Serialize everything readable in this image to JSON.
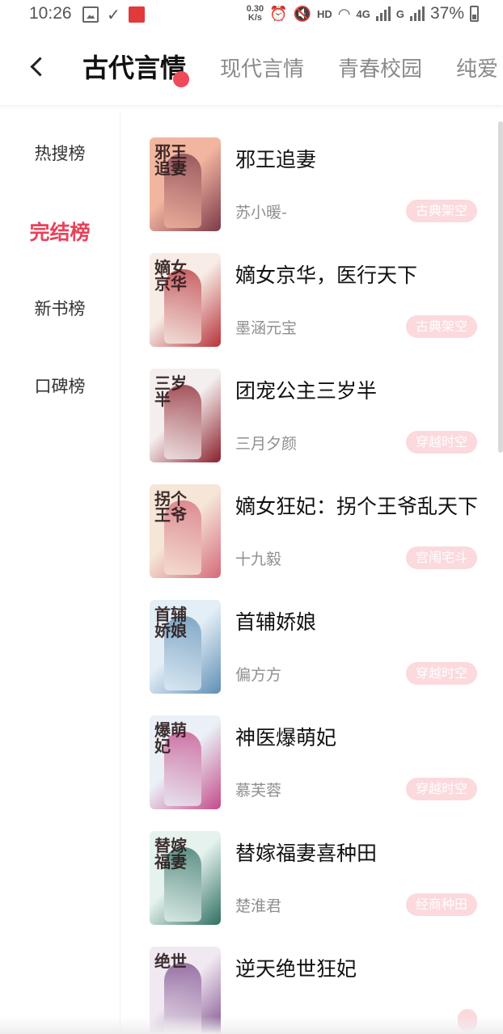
{
  "status_bar": {
    "time": "10:26",
    "speed_value": "0.30",
    "speed_unit": "K/s",
    "hd": "HD",
    "network": "4G",
    "network2": "G",
    "battery": "37%"
  },
  "header": {
    "tabs": [
      {
        "label": "古代言情",
        "active": true
      },
      {
        "label": "现代言情",
        "active": false
      },
      {
        "label": "青春校园",
        "active": false
      },
      {
        "label": "纯爱",
        "active": false
      }
    ]
  },
  "sidebar": {
    "items": [
      {
        "label": "热搜榜",
        "active": false
      },
      {
        "label": "完结榜",
        "active": true
      },
      {
        "label": "新书榜",
        "active": false
      },
      {
        "label": "口碑榜",
        "active": false
      }
    ]
  },
  "books": [
    {
      "title": "邪王追妻",
      "author": "苏小暖-",
      "tag": "古典架空",
      "cover_text": "邪王追妻",
      "cover_colors": [
        "#f2b6a0",
        "#7b3a4a"
      ]
    },
    {
      "title": "嫡女京华，医行天下",
      "author": "墨涵元宝",
      "tag": "古典架空",
      "cover_text": "嫡女京华",
      "cover_colors": [
        "#f7ede6",
        "#b8323a"
      ]
    },
    {
      "title": "团宠公主三岁半",
      "author": "三月夕颜",
      "tag": "穿越时空",
      "cover_text": "三岁半",
      "cover_colors": [
        "#f4eeee",
        "#8a1f2a"
      ]
    },
    {
      "title": "嫡女狂妃：拐个王爷乱天下",
      "author": "十九毅",
      "tag": "宫闱宅斗",
      "cover_text": "拐个王爷",
      "cover_colors": [
        "#f6e6d8",
        "#d46a7a"
      ]
    },
    {
      "title": "首辅娇娘",
      "author": "偏方方",
      "tag": "穿越时空",
      "cover_text": "首辅娇娘",
      "cover_colors": [
        "#e3eef6",
        "#5f8fb5"
      ]
    },
    {
      "title": "神医爆萌妃",
      "author": "慕芙蓉",
      "tag": "穿越时空",
      "cover_text": "爆萌妃",
      "cover_colors": [
        "#eaf0f6",
        "#c44a8a"
      ]
    },
    {
      "title": "替嫁福妻喜种田",
      "author": "楚淮君",
      "tag": "经商种田",
      "cover_text": "替嫁福妻",
      "cover_colors": [
        "#e6f2ee",
        "#2f6f62"
      ]
    },
    {
      "title": "逆天绝世狂妃",
      "author": "",
      "tag": "",
      "cover_text": "绝世",
      "cover_colors": [
        "#f1e9f2",
        "#7a4a8a"
      ]
    }
  ],
  "colors": {
    "accent": "#e8425a",
    "tag_bg": "#fbd9dd",
    "tab_dot": "#ef4a5a"
  },
  "icons": {
    "back": "chevron-left-icon"
  }
}
